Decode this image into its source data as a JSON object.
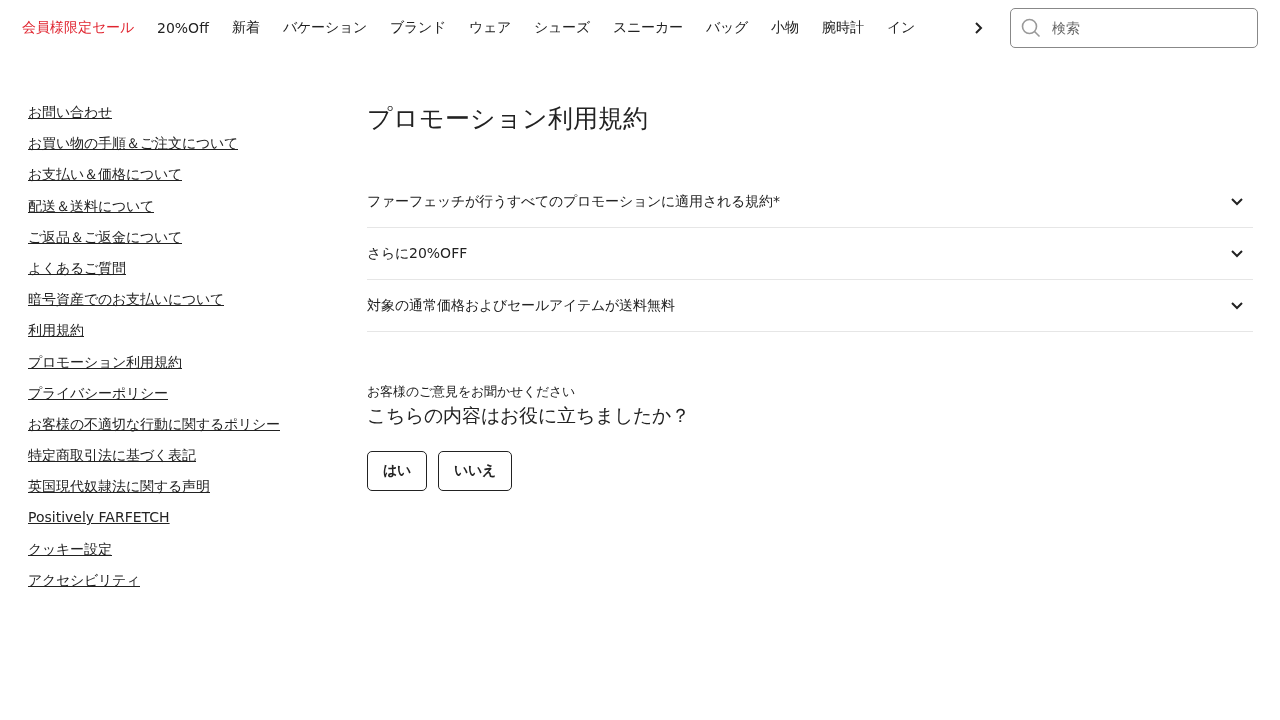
{
  "nav": {
    "items": [
      {
        "label": "会員様限定セール",
        "kind": "sale"
      },
      {
        "label": "20%Off",
        "kind": "normal"
      },
      {
        "label": "新着",
        "kind": "normal"
      },
      {
        "label": "バケーション",
        "kind": "normal"
      },
      {
        "label": "ブランド",
        "kind": "normal"
      },
      {
        "label": "ウェア",
        "kind": "normal"
      },
      {
        "label": "シューズ",
        "kind": "normal"
      },
      {
        "label": "スニーカー",
        "kind": "normal"
      },
      {
        "label": "バッグ",
        "kind": "normal"
      },
      {
        "label": "小物",
        "kind": "normal"
      },
      {
        "label": "腕時計",
        "kind": "normal"
      },
      {
        "label": "イン",
        "kind": "normal"
      }
    ],
    "search": {
      "placeholder": "検索"
    }
  },
  "sidebar": {
    "items": [
      "お問い合わせ",
      "お買い物の手順＆ご注文について",
      "お支払い＆価格について",
      "配送＆送料について",
      "ご返品＆ご返金について",
      "よくあるご質問",
      "暗号資産でのお支払いについて",
      "利用規約",
      "プロモーション利用規約",
      "プライバシーポリシー",
      "お客様の不適切な行動に関するポリシー",
      "特定商取引法に基づく表記",
      "英国現代奴隷法に関する声明",
      "Positively FARFETCH",
      "クッキー設定",
      "アクセシビリティ"
    ]
  },
  "main": {
    "title": "プロモーション利用規約",
    "accordion": [
      {
        "label": "ファーフェッチが行うすべてのプロモーションに適用される規約*",
        "expanded": false
      },
      {
        "label": "さらに20%OFF",
        "expanded": false
      },
      {
        "label": "対象の通常価格およびセールアイテムが送料無料",
        "expanded": false
      }
    ],
    "feedback": {
      "eyebrow": "お客様のご意見をお聞かせください",
      "question": "こちらの内容はお役に立ちましたか？",
      "buttons": [
        "はい",
        "いいえ"
      ]
    }
  }
}
